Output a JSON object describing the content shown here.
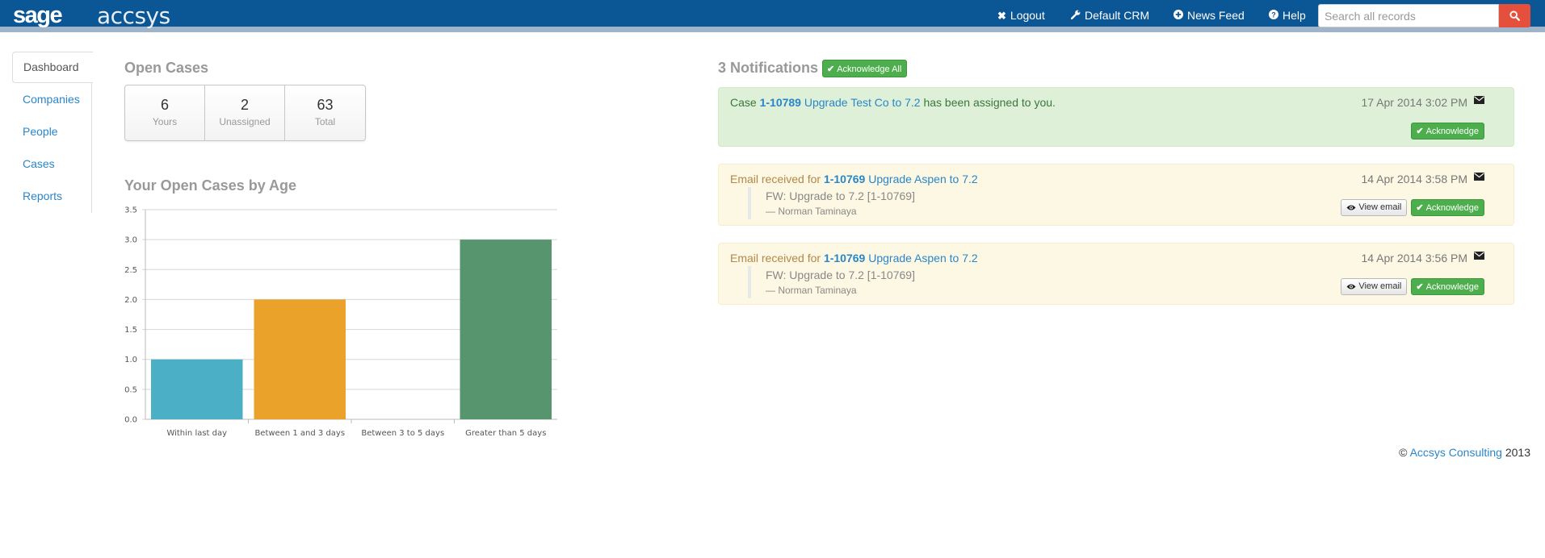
{
  "brand": {
    "logo_primary": "sage",
    "logo_secondary": "accsys"
  },
  "topnav": {
    "logout": "Logout",
    "default_crm": "Default CRM",
    "news_feed": "News Feed",
    "help": "Help",
    "search_placeholder": "Search all records",
    "bar_color": "#0b5694",
    "search_button_color": "#e5503c"
  },
  "sidebar": {
    "items": [
      {
        "label": "Dashboard",
        "active": true
      },
      {
        "label": "Companies"
      },
      {
        "label": "People"
      },
      {
        "label": "Cases"
      },
      {
        "label": "Reports"
      }
    ]
  },
  "open_cases": {
    "title": "Open Cases",
    "stats": [
      {
        "value": "6",
        "label": "Yours"
      },
      {
        "value": "2",
        "label": "Unassigned"
      },
      {
        "value": "63",
        "label": "Total"
      }
    ]
  },
  "age_chart": {
    "title": "Your Open Cases by Age"
  },
  "chart_data": {
    "type": "bar",
    "title": "Your Open Cases by Age",
    "categories": [
      "Within last day",
      "Between 1 and 3 days",
      "Between 3 to 5 days",
      "Greater than 5 days"
    ],
    "values": [
      1,
      2,
      0,
      3
    ],
    "colors": [
      "#4bb0c6",
      "#eba22a",
      "#7fbf7f",
      "#57956f"
    ],
    "ylim": [
      0,
      3.5
    ],
    "yticks": [
      "0.0",
      "0.5",
      "1.0",
      "1.5",
      "2.0",
      "2.5",
      "3.0",
      "3.5"
    ],
    "grid": true,
    "legend": "none"
  },
  "notifications": {
    "heading": "3 Notifications",
    "ack_all_label": "Acknowledge All",
    "items": [
      {
        "prefix": "Case ",
        "case_id": "1-10789",
        "case_title": "Upgrade Test Co to 7.2",
        "suffix": " has been assigned to you.",
        "date": "17 Apr 2014 3:02 PM",
        "ack_label": "Acknowledge",
        "style": "success"
      },
      {
        "prefix": "Email received for ",
        "case_id": "1-10769",
        "case_title": "Upgrade Aspen to 7.2",
        "date": "14 Apr 2014 3:58 PM",
        "subject": "FW: Upgrade to 7.2 [1-10769]",
        "from": "— Norman Taminaya",
        "view_label": "View email",
        "ack_label": "Acknowledge",
        "style": "warning"
      },
      {
        "prefix": "Email received for ",
        "case_id": "1-10769",
        "case_title": "Upgrade Aspen to 7.2",
        "date": "14 Apr 2014 3:56 PM",
        "subject": "FW: Upgrade to 7.2 [1-10769]",
        "from": "— Norman Taminaya",
        "view_label": "View email",
        "ack_label": "Acknowledge",
        "style": "warning"
      }
    ]
  },
  "footer": {
    "copyright_symbol": "©",
    "company": "Accsys Consulting",
    "year": "2013"
  }
}
